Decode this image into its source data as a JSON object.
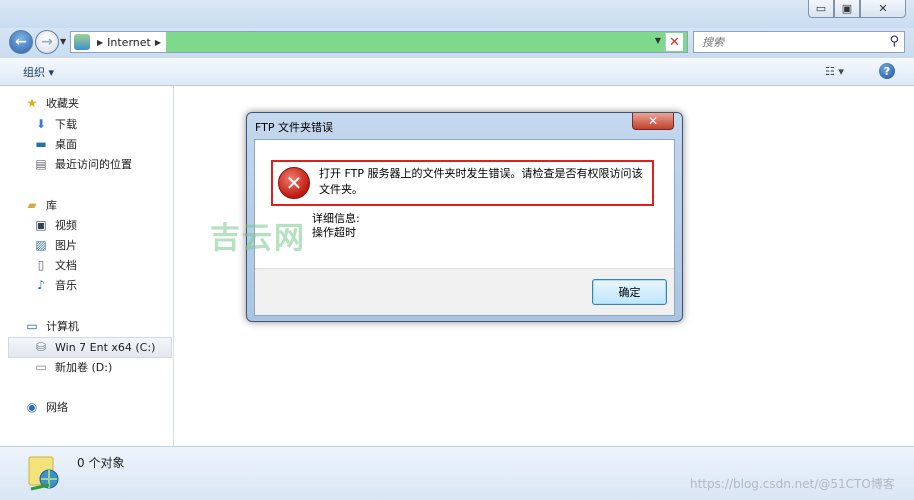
{
  "window": {
    "minimize_glyph": "▭",
    "maximize_glyph": "▣",
    "close_glyph": "✕"
  },
  "address": {
    "crumb": "Internet",
    "search_placeholder": "搜索"
  },
  "toolbar": {
    "organize_label": "组织 ▾",
    "view_label": "☷ ▾",
    "help_label": "?"
  },
  "sidebar": {
    "favorites_label": "收藏夹",
    "favorites": [
      "下载",
      "桌面",
      "最近访问的位置"
    ],
    "libraries_label": "库",
    "libraries": [
      "视频",
      "图片",
      "文档",
      "音乐"
    ],
    "computer_label": "计算机",
    "drives": [
      "Win 7 Ent x64 (C:)",
      "新加卷 (D:)"
    ],
    "network_label": "网络"
  },
  "status": {
    "object_count": "0 个对象",
    "watermark": "https://blog.csdn.net/@51CTO博客"
  },
  "dialog": {
    "title": "FTP 文件夹错误",
    "message": "打开 FTP 服务器上的文件夹时发生错误。请检查是否有权限访问该文件夹。",
    "details_label": "详细信息:",
    "details_value": "操作超时",
    "ok_label": "确定"
  },
  "overlay_watermark": "吉云网",
  "colors": {
    "highlight_border": "#e0201b",
    "address_fill": "#7fd98c",
    "error_red": "#c0180f"
  }
}
